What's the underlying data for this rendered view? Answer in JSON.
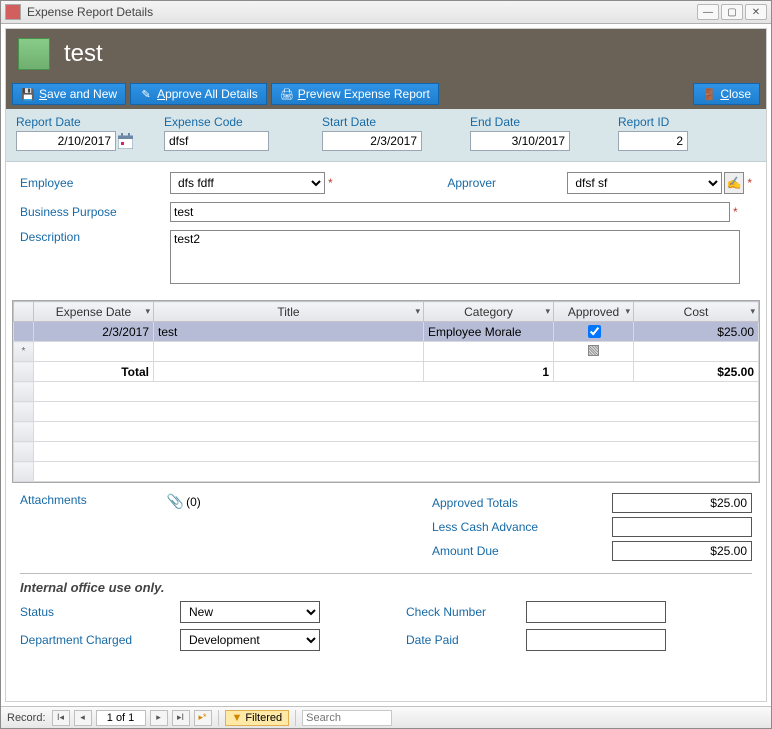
{
  "window": {
    "title": "Expense Report Details"
  },
  "header": {
    "title": "test"
  },
  "toolbar": {
    "save_and_new": "Save and New",
    "approve_all": "Approve All Details",
    "preview": "Preview Expense Report",
    "close": "Close"
  },
  "top_fields": {
    "report_date": {
      "label": "Report Date",
      "value": "2/10/2017"
    },
    "expense_code": {
      "label": "Expense Code",
      "value": "dfsf"
    },
    "start_date": {
      "label": "Start Date",
      "value": "2/3/2017"
    },
    "end_date": {
      "label": "End Date",
      "value": "3/10/2017"
    },
    "report_id": {
      "label": "Report ID",
      "value": "2"
    }
  },
  "main_fields": {
    "employee_label": "Employee",
    "employee_value": "dfs fdff",
    "approver_label": "Approver",
    "approver_value": "dfsf sf",
    "bp_label": "Business Purpose",
    "bp_value": "test",
    "desc_label": "Description",
    "desc_value": "test2"
  },
  "grid": {
    "columns": {
      "expense_date": "Expense Date",
      "title": "Title",
      "category": "Category",
      "approved": "Approved",
      "cost": "Cost"
    },
    "rows": [
      {
        "expense_date": "2/3/2017",
        "title": "test",
        "category": "Employee Morale",
        "approved": true,
        "cost": "$25.00"
      }
    ],
    "total_label": "Total",
    "total_count": "1",
    "total_cost": "$25.00"
  },
  "attachments": {
    "label": "Attachments",
    "count_display": "(0)"
  },
  "totals": {
    "approved_totals": {
      "label": "Approved Totals",
      "value": "$25.00"
    },
    "less_cash_advance": {
      "label": "Less Cash Advance",
      "value": ""
    },
    "amount_due": {
      "label": "Amount Due",
      "value": "$25.00"
    }
  },
  "internal": {
    "heading": "Internal office use only.",
    "status_label": "Status",
    "status_value": "New",
    "dept_label": "Department Charged",
    "dept_value": "Development",
    "check_label": "Check Number",
    "check_value": "",
    "date_paid_label": "Date Paid",
    "date_paid_value": ""
  },
  "statusbar": {
    "record_label": "Record:",
    "position": "1 of 1",
    "filtered": "Filtered",
    "search_placeholder": "Search"
  }
}
